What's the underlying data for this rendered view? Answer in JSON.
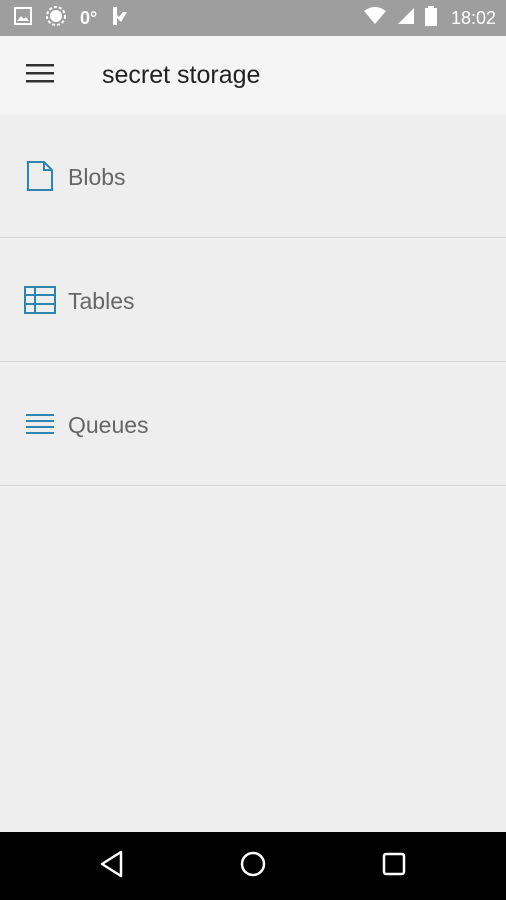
{
  "status_bar": {
    "left_icons": [
      "image-icon",
      "sync-icon",
      "temperature-text",
      "flag-icon"
    ],
    "temperature": "0°",
    "right_icons": [
      "wifi-icon",
      "signal-icon",
      "battery-icon"
    ],
    "time": "18:02"
  },
  "app_bar": {
    "menu_icon": "hamburger-menu-icon",
    "title": "secret storage"
  },
  "list": {
    "items": [
      {
        "label": "Blobs",
        "icon": "document-icon"
      },
      {
        "label": "Tables",
        "icon": "table-icon"
      },
      {
        "label": "Queues",
        "icon": "queue-lines-icon"
      }
    ]
  },
  "nav_bar": {
    "back_icon": "back-triangle-icon",
    "home_icon": "home-circle-icon",
    "recents_icon": "recents-square-icon"
  },
  "colors": {
    "status_bar_bg": "#9e9e9e",
    "app_bar_bg": "#f5f5f5",
    "content_bg": "#eeeeee",
    "icon_accent": "#2e86b0",
    "label_text": "#666666",
    "nav_bar_bg": "#000000"
  }
}
